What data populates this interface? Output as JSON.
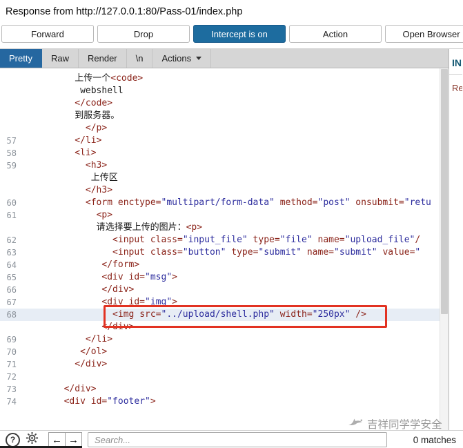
{
  "window": {
    "title": "Response from http://127.0.0.1:80/Pass-01/index.php"
  },
  "toolbar": {
    "buttons": [
      {
        "label": "Forward",
        "active": false
      },
      {
        "label": "Drop",
        "active": false
      },
      {
        "label": "Intercept is on",
        "active": true
      },
      {
        "label": "Action",
        "active": false
      },
      {
        "label": "Open Browser",
        "active": false
      }
    ]
  },
  "tabs": {
    "items": [
      {
        "label": "Pretty",
        "selected": true,
        "has_dropdown": false
      },
      {
        "label": "Raw",
        "selected": false,
        "has_dropdown": false
      },
      {
        "label": "Render",
        "selected": false,
        "has_dropdown": false
      },
      {
        "label": "\\n",
        "selected": false,
        "has_dropdown": false
      },
      {
        "label": "Actions",
        "selected": false,
        "has_dropdown": true
      }
    ]
  },
  "inspector": {
    "header": "IN",
    "section": "Re"
  },
  "editor": {
    "lines": [
      {
        "num": "",
        "indent": 10,
        "hl": false,
        "parts": [
          {
            "t": "text",
            "s": "上传一个"
          },
          {
            "t": "tag",
            "s": "<code>"
          }
        ]
      },
      {
        "num": "",
        "indent": 11,
        "hl": false,
        "parts": [
          {
            "t": "text",
            "s": "webshell"
          }
        ]
      },
      {
        "num": "",
        "indent": 10,
        "hl": false,
        "parts": [
          {
            "t": "tag",
            "s": "</code>"
          }
        ]
      },
      {
        "num": "",
        "indent": 10,
        "hl": false,
        "parts": [
          {
            "t": "text",
            "s": "到服务器。"
          }
        ]
      },
      {
        "num": "",
        "indent": 12,
        "hl": false,
        "parts": [
          {
            "t": "tag",
            "s": "</p>"
          }
        ]
      },
      {
        "num": "57",
        "indent": 10,
        "hl": false,
        "parts": [
          {
            "t": "tag",
            "s": "</li>"
          }
        ]
      },
      {
        "num": "58",
        "indent": 10,
        "hl": false,
        "parts": [
          {
            "t": "tag",
            "s": "<li>"
          }
        ]
      },
      {
        "num": "59",
        "indent": 12,
        "hl": false,
        "parts": [
          {
            "t": "tag",
            "s": "<h3>"
          }
        ]
      },
      {
        "num": "",
        "indent": 13,
        "hl": false,
        "parts": [
          {
            "t": "text",
            "s": "上传区"
          }
        ]
      },
      {
        "num": "",
        "indent": 12,
        "hl": false,
        "parts": [
          {
            "t": "tag",
            "s": "</h3>"
          }
        ]
      },
      {
        "num": "60",
        "indent": 12,
        "hl": false,
        "parts": [
          {
            "t": "tag",
            "s": "<form "
          },
          {
            "t": "attr",
            "s": "enctype="
          },
          {
            "t": "str",
            "s": "\"multipart/form-data\""
          },
          {
            "t": "attr",
            "s": " method="
          },
          {
            "t": "str",
            "s": "\"post\""
          },
          {
            "t": "attr",
            "s": " onsubmit="
          },
          {
            "t": "str",
            "s": "\"retu"
          }
        ]
      },
      {
        "num": "61",
        "indent": 14,
        "hl": false,
        "parts": [
          {
            "t": "tag",
            "s": "<p>"
          }
        ]
      },
      {
        "num": "",
        "indent": 14,
        "hl": false,
        "parts": [
          {
            "t": "text",
            "s": "请选择要上传的图片："
          },
          {
            "t": "tag",
            "s": "<p>"
          }
        ]
      },
      {
        "num": "62",
        "indent": 17,
        "hl": false,
        "parts": [
          {
            "t": "tag",
            "s": "<input "
          },
          {
            "t": "attr",
            "s": "class="
          },
          {
            "t": "str",
            "s": "\"input_file\""
          },
          {
            "t": "attr",
            "s": " type="
          },
          {
            "t": "str",
            "s": "\"file\""
          },
          {
            "t": "attr",
            "s": " name="
          },
          {
            "t": "str",
            "s": "\"upload_file\""
          },
          {
            "t": "tag",
            "s": "/"
          }
        ]
      },
      {
        "num": "63",
        "indent": 17,
        "hl": false,
        "parts": [
          {
            "t": "tag",
            "s": "<input "
          },
          {
            "t": "attr",
            "s": "class="
          },
          {
            "t": "str",
            "s": "\"button\""
          },
          {
            "t": "attr",
            "s": " type="
          },
          {
            "t": "str",
            "s": "\"submit\""
          },
          {
            "t": "attr",
            "s": " name="
          },
          {
            "t": "str",
            "s": "\"submit\""
          },
          {
            "t": "attr",
            "s": " value="
          },
          {
            "t": "str",
            "s": "\""
          }
        ]
      },
      {
        "num": "64",
        "indent": 15,
        "hl": false,
        "parts": [
          {
            "t": "tag",
            "s": "</form>"
          }
        ]
      },
      {
        "num": "65",
        "indent": 15,
        "hl": false,
        "parts": [
          {
            "t": "tag",
            "s": "<div "
          },
          {
            "t": "attr",
            "s": "id="
          },
          {
            "t": "str",
            "s": "\"msg\""
          },
          {
            "t": "tag",
            "s": ">"
          }
        ]
      },
      {
        "num": "66",
        "indent": 15,
        "hl": false,
        "parts": [
          {
            "t": "tag",
            "s": "</div>"
          }
        ]
      },
      {
        "num": "67",
        "indent": 15,
        "hl": false,
        "parts": [
          {
            "t": "tag",
            "s": "<div "
          },
          {
            "t": "attr",
            "s": "id="
          },
          {
            "t": "str",
            "s": "\"img\""
          },
          {
            "t": "tag",
            "s": ">"
          }
        ]
      },
      {
        "num": "68",
        "indent": 17,
        "hl": true,
        "parts": [
          {
            "t": "tag",
            "s": "<img "
          },
          {
            "t": "attr",
            "s": "src="
          },
          {
            "t": "str",
            "s": "\"../upload/shell.php\""
          },
          {
            "t": "attr",
            "s": " width="
          },
          {
            "t": "str",
            "s": "\"250px\""
          },
          {
            "t": "tag",
            "s": " />"
          }
        ]
      },
      {
        "num": "",
        "indent": 15,
        "hl": false,
        "parts": [
          {
            "t": "tag",
            "s": "</div>"
          }
        ]
      },
      {
        "num": "69",
        "indent": 12,
        "hl": false,
        "parts": [
          {
            "t": "tag",
            "s": "</li>"
          }
        ]
      },
      {
        "num": "70",
        "indent": 11,
        "hl": false,
        "parts": [
          {
            "t": "tag",
            "s": "</ol>"
          }
        ]
      },
      {
        "num": "71",
        "indent": 10,
        "hl": false,
        "parts": [
          {
            "t": "tag",
            "s": "</div>"
          }
        ]
      },
      {
        "num": "72",
        "indent": 0,
        "hl": false,
        "parts": []
      },
      {
        "num": "73",
        "indent": 8,
        "hl": false,
        "parts": [
          {
            "t": "tag",
            "s": "</div>"
          }
        ]
      },
      {
        "num": "74",
        "indent": 8,
        "hl": false,
        "parts": [
          {
            "t": "tag",
            "s": "<div "
          },
          {
            "t": "attr",
            "s": "id="
          },
          {
            "t": "str",
            "s": "\"footer\""
          },
          {
            "t": "tag",
            "s": ">"
          }
        ]
      }
    ]
  },
  "statusbar": {
    "help_label": "?",
    "back_arrow": "←",
    "forward_arrow": "→",
    "search_placeholder": "Search...",
    "matches": "0 matches"
  },
  "watermark": {
    "text": "吉祥同学学安全"
  },
  "colors": {
    "intercept_active_bg": "#1d6c9f",
    "selected_tab_bg": "#2567a0",
    "highlight_box_border": "#e23222",
    "code_tag": "#8b241a",
    "code_string": "#2d2d9e"
  }
}
